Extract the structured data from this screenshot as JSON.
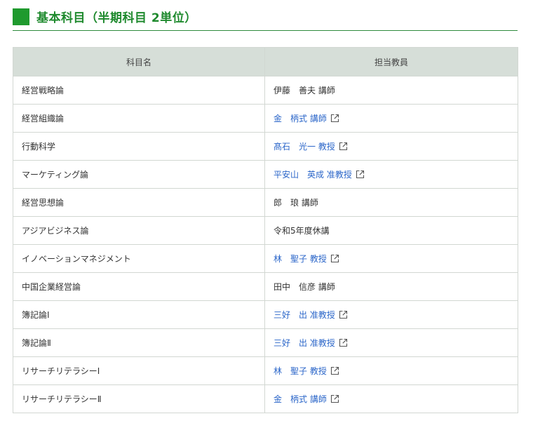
{
  "heading": {
    "title": "基本科目（半期科目 2単位）"
  },
  "table": {
    "headers": {
      "course": "科目名",
      "teacher": "担当教員"
    },
    "rows": [
      {
        "course": "経営戦略論",
        "teacher": "伊藤　善夫 講師",
        "is_link": false
      },
      {
        "course": "経営組織論",
        "teacher": "金　柄式 講師",
        "is_link": true
      },
      {
        "course": "行動科学",
        "teacher": "髙石　光一 教授",
        "is_link": true
      },
      {
        "course": "マーケティング論",
        "teacher": "平安山　英成 准教授",
        "is_link": true
      },
      {
        "course": "経営思想論",
        "teacher": "郎　琅 講師",
        "is_link": false
      },
      {
        "course": "アジアビジネス論",
        "teacher": "令和5年度休講",
        "is_link": false
      },
      {
        "course": "イノベーションマネジメント",
        "teacher": "林　聖子 教授",
        "is_link": true
      },
      {
        "course": "中国企業経営論",
        "teacher": "田中　信彦 講師",
        "is_link": false
      },
      {
        "course": "簿記論Ⅰ",
        "teacher": "三好　出 准教授",
        "is_link": true
      },
      {
        "course": "簿記論Ⅱ",
        "teacher": "三好　出 准教授",
        "is_link": true
      },
      {
        "course": "リサーチリテラシーⅠ",
        "teacher": "林　聖子 教授",
        "is_link": true
      },
      {
        "course": "リサーチリテラシーⅡ",
        "teacher": "金　柄式 講師",
        "is_link": true
      }
    ]
  },
  "icons": {
    "external_link": "external-link-icon"
  },
  "colors": {
    "accent_green": "#1f9a2e",
    "heading_text": "#1f8a2e",
    "header_bg": "#d6ded8",
    "link_blue": "#2b66c9"
  }
}
